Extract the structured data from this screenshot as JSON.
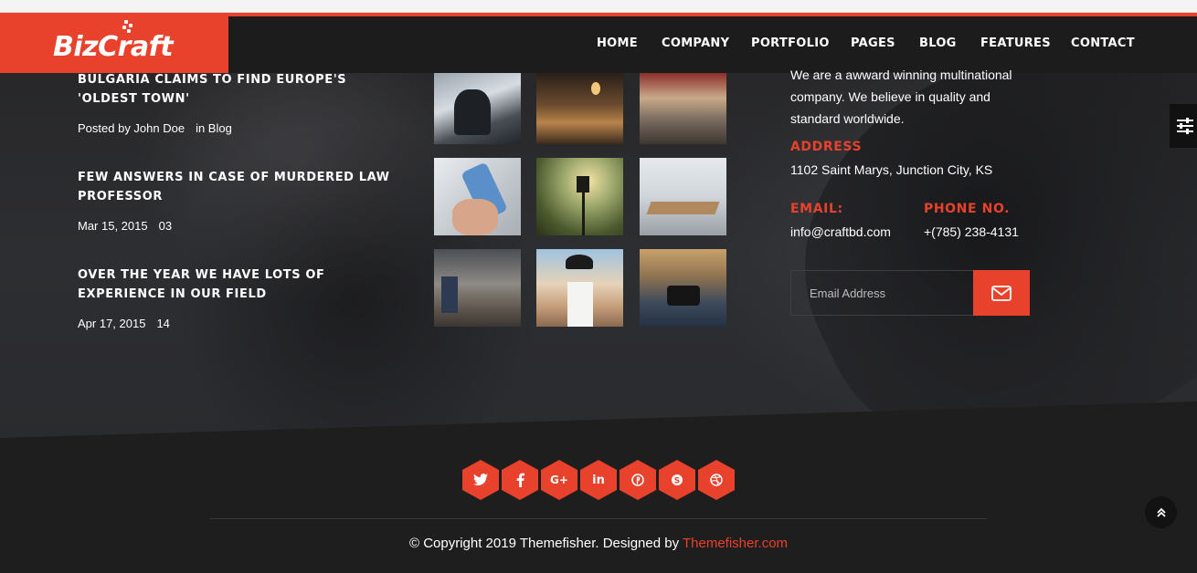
{
  "brand": {
    "logo_text": "BizCraft",
    "accent": "#e8412c"
  },
  "nav": {
    "items": [
      {
        "label": "HOME",
        "active": true
      },
      {
        "label": "COMPANY"
      },
      {
        "label": "PORTFOLIO"
      },
      {
        "label": "PAGES"
      },
      {
        "label": "BLOG"
      },
      {
        "label": "FEATURES"
      },
      {
        "label": "CONTACT"
      }
    ]
  },
  "posts": [
    {
      "title": "Bulgaria claims to find Europe's 'oldest town'",
      "meta_1": "Posted by John Doe",
      "meta_2": "in Blog"
    },
    {
      "title": "Few answers in case of murdered law professor",
      "meta_1": "Mar 15, 2015",
      "meta_2": "03"
    },
    {
      "title": "Over the year we have lots of experience in our field",
      "meta_1": "Apr 17, 2015",
      "meta_2": "14"
    }
  ],
  "gallery": {
    "images": [
      "photographer",
      "restaurant",
      "mall",
      "smartphone",
      "street-lamp",
      "meeting-room",
      "shop",
      "woman-camera",
      "camera-hands"
    ]
  },
  "about": {
    "intro": "We are a awward winning multinational company. We believe in quality and standard worldwide.",
    "address_label": "ADDRESS",
    "address": "1102 Saint Marys, Junction City, KS",
    "email_label": "EMAIL:",
    "email": "info@craftbd.com",
    "phone_label": "PHONE NO.",
    "phone": "+(785) 238-4131"
  },
  "subscribe": {
    "placeholder": "Email Address"
  },
  "social": [
    "twitter-icon",
    "facebook-icon",
    "google-plus-icon",
    "linkedin-icon",
    "pinterest-icon",
    "skype-icon",
    "dribbble-icon"
  ],
  "footer": {
    "copyright": "© Copyright 2019 Themefisher. Designed by",
    "designer_link": "Themefisher.com"
  }
}
